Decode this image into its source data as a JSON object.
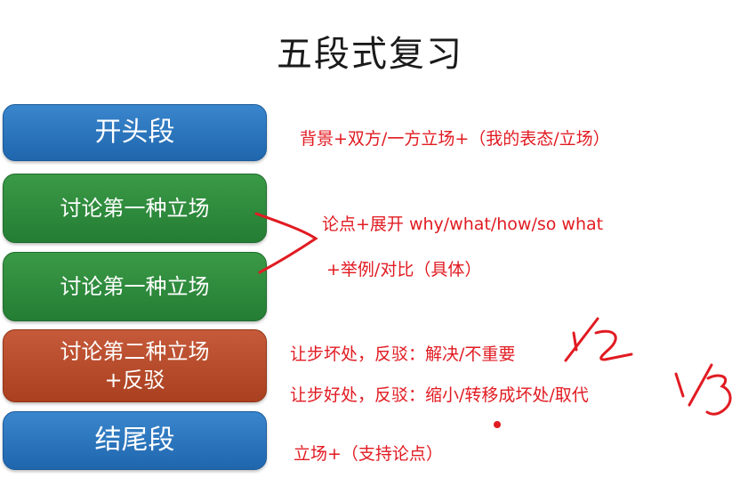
{
  "title": "五段式复习",
  "boxes": {
    "opening": "开头段",
    "position1_a": "讨论第一种立场",
    "position1_b": "讨论第一种立场",
    "position2_line1": "讨论第二种立场",
    "position2_line2": "+反驳",
    "ending": "结尾段"
  },
  "notes": {
    "opening": "背景+双方/一方立场+（我的表态/立场）",
    "arguments_1": "论点+展开 why/what/how/so what",
    "arguments_2": "+举例/对比（具体）",
    "concession_1": "让步坏处，反驳：解决/不重要",
    "concession_2": "让步好处，反驳：缩小/转移成坏处/取代",
    "ending": "立场+（支持论点）"
  },
  "handwriting": {
    "fraction_1": "1/2",
    "fraction_2": "1/3"
  },
  "colors": {
    "blue": "#2a74bd",
    "green": "#2e8b3c",
    "red": "#b84a2b",
    "annotation": "#e11b22"
  }
}
